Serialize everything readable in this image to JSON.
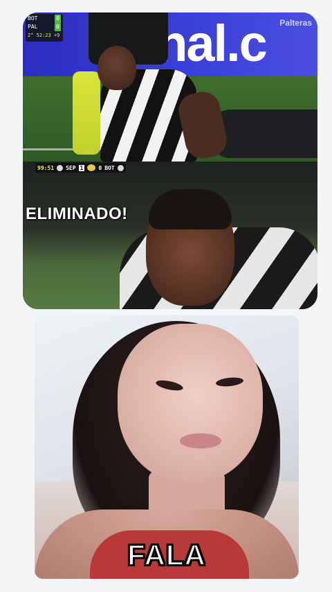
{
  "clip_top": {
    "ad_text": "onal.c",
    "watermark": "Palteras",
    "scorebox": {
      "home_team": "BOT",
      "home_score": "0",
      "away_team": "PAL",
      "away_score": "0",
      "clock": "2° 52:23 +9"
    }
  },
  "clip_middle": {
    "scorebar": {
      "time": "99:51",
      "team_a": "SEP",
      "score_a": "1",
      "score_b": "0",
      "team_b": "BOT"
    },
    "caption": "ELIMINADO!"
  },
  "clip_bottom": {
    "caption": "FALA"
  }
}
